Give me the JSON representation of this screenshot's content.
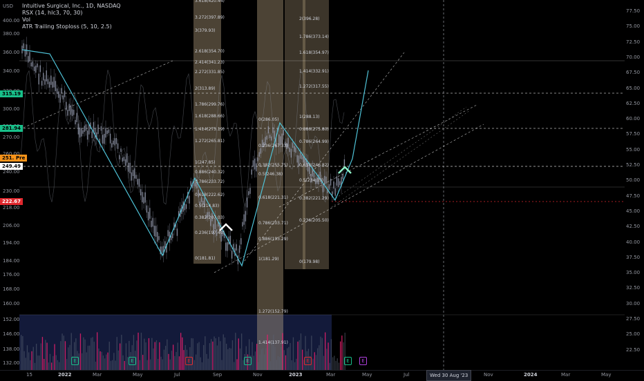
{
  "chart": {
    "currency": "USD",
    "legend": [
      "Intuitive Surgical, Inc., 1D, NASDAQ",
      "RSX (14, hlc3, 70, 30)",
      "Vol",
      "ATR Trailing Stoploss (5, 10, 2.5)"
    ],
    "colors": {
      "background": "#000000",
      "trend_line": "#4fc3d8",
      "candle": "#9aa0b4",
      "fib_band": "#c8b08c",
      "up_arrow_cyan": "#8ff0c8",
      "up_arrow_white": "#ffffff",
      "volume_down": "#e0206a",
      "volume_up": "#5a6272",
      "volume_zone": "#23306a"
    }
  },
  "left_axis": {
    "ticks": [
      "400.00",
      "380.00",
      "360.00",
      "340.00",
      "320.00",
      "300.00",
      "290.00",
      "270.00",
      "260.00",
      "240.00",
      "230.00",
      "218.00",
      "206.00",
      "194.00",
      "184.00",
      "176.00",
      "168.00",
      "160.00",
      "152.00",
      "146.00",
      "138.00",
      "132.00"
    ],
    "tags": [
      {
        "label": "315.19",
        "bg": "#18c08a",
        "fg": "#000000"
      },
      {
        "label": "281.94",
        "bg": "#18c08a",
        "fg": "#000000"
      },
      {
        "label": "251.67",
        "bg": "#f7931a",
        "fg": "#000000"
      },
      {
        "label": "Pre",
        "bg": "#f7931a",
        "fg": "#000000"
      },
      {
        "label": "249.49",
        "bg": "#ffffff",
        "fg": "#000000"
      },
      {
        "label": "222.67",
        "bg": "#e0282e",
        "fg": "#ffffff"
      }
    ]
  },
  "right_axis": {
    "ticks": [
      "77.50",
      "75.00",
      "72.50",
      "70.00",
      "67.50",
      "65.00",
      "62.50",
      "60.00",
      "57.50",
      "55.00",
      "52.50",
      "50.00",
      "47.50",
      "45.00",
      "42.50",
      "40.00",
      "37.50",
      "35.00",
      "32.50",
      "30.00",
      "27.50",
      "25.00",
      "22.50"
    ]
  },
  "time_axis": {
    "labels": [
      {
        "t": "15",
        "bold": false
      },
      {
        "t": "2022",
        "bold": true
      },
      {
        "t": "Mar",
        "bold": false
      },
      {
        "t": "May",
        "bold": false
      },
      {
        "t": "Jul",
        "bold": false
      },
      {
        "t": "Sep",
        "bold": false
      },
      {
        "t": "Nov",
        "bold": false
      },
      {
        "t": "2023",
        "bold": true
      },
      {
        "t": "Mar",
        "bold": false
      },
      {
        "t": "May",
        "bold": false
      },
      {
        "t": "Jul",
        "bold": false
      },
      {
        "t": "Nov",
        "bold": false
      },
      {
        "t": "2024",
        "bold": true
      },
      {
        "t": "Mar",
        "bold": false
      },
      {
        "t": "May",
        "bold": false
      }
    ],
    "crosshair_date": "Wed 30 Aug '23"
  },
  "fib_left": [
    "3.618(420.44)",
    "3.272(397.89)",
    "3(379.93)",
    "2.618(354.70)",
    "2.414(341.23)",
    "2.272(331.85)",
    "2(313.89)",
    "1.786(299.76)",
    "1.618(288.66)",
    "1.414(275.19)",
    "1.272(265.81)",
    "1(247.85)",
    "0.886(240.32)",
    "0.786(233.72)",
    "0.618(222.62)",
    "0.5(214.83)",
    "0.382(207.03)",
    "0.236(197.40)",
    "0(181.81)"
  ],
  "fib_mid": [
    "0(286.05)",
    "0.236(267.33)",
    "0.382(255.75)",
    "0.5(246.38)",
    "0.618(221.31)",
    "0.786(203.71)",
    "0.886(193.29)",
    "1(181.29)",
    "1.272(152.79)",
    "1.414(137.91)"
  ],
  "fib_right": [
    "2(396.28)",
    "1.786(373.14)",
    "1.618(354.97)",
    "1.414(332.91)",
    "1.272(317.55)",
    "1(288.13)",
    "0.886(275.80)",
    "0.786(264.99)",
    "0.618(246.82)",
    "0.5(234.05)",
    "0.382(221.29)",
    "0.236(205.50)",
    "0(179.98)"
  ],
  "events": [
    {
      "label": "E",
      "color": "#18c08a"
    },
    {
      "label": "E",
      "color": "#18c08a"
    },
    {
      "label": "E",
      "color": "#e0282e"
    },
    {
      "label": "E",
      "color": "#18c08a"
    },
    {
      "label": "E",
      "color": "#e0282e"
    },
    {
      "label": "E",
      "color": "#18c08a"
    },
    {
      "label": "E",
      "color": "#b040e0"
    }
  ]
}
